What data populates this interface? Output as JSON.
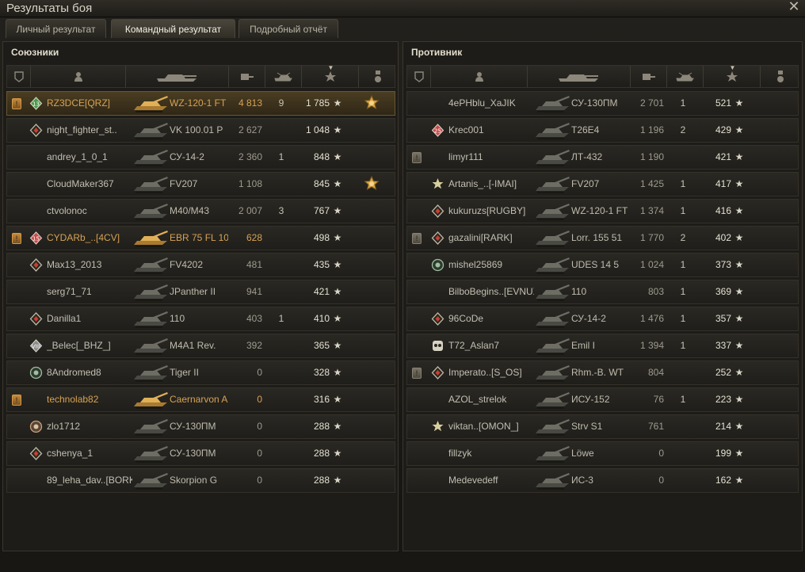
{
  "window": {
    "title": "Результаты боя"
  },
  "tabs": [
    {
      "label": "Личный результат",
      "active": false
    },
    {
      "label": "Командный результат",
      "active": true
    },
    {
      "label": "Подробный отчёт",
      "active": false
    }
  ],
  "allies": {
    "title": "Союзники",
    "rows": [
      {
        "squad": "",
        "badge": "rank-13-icon",
        "badge_text": "13",
        "name": "RZ3DCE[QRZ]",
        "tank": "WZ-120-1 FT",
        "damage": "4 813",
        "frags": "9",
        "xp": "1 785",
        "medal": true,
        "self": true,
        "platoon": true
      },
      {
        "squad": "",
        "badge": "diamond-icon",
        "name": "night_fighter_st..",
        "tank": "VK 100.01 P",
        "damage": "2 627",
        "frags": "",
        "xp": "1 048",
        "medal": false
      },
      {
        "squad": "",
        "badge": "",
        "name": "andrey_1_0_1",
        "tank": "СУ-14-2",
        "damage": "2 360",
        "frags": "1",
        "xp": "848",
        "medal": false
      },
      {
        "squad": "",
        "badge": "",
        "name": "CloudMaker367",
        "tank": "FV207",
        "damage": "1 108",
        "frags": "",
        "xp": "845",
        "medal": true
      },
      {
        "squad": "",
        "badge": "",
        "name": "ctvolonoc",
        "tank": "M40/M43",
        "damage": "2 007",
        "frags": "3",
        "xp": "767",
        "medal": false
      },
      {
        "squad": "",
        "badge": "rank-15-icon",
        "badge_text": "15",
        "name": "CYDARb_..[4CV]",
        "tank": "EBR 75 FL 10",
        "damage": "628",
        "frags": "",
        "xp": "498",
        "medal": false,
        "platoon": true
      },
      {
        "squad": "",
        "badge": "diamond-icon",
        "name": "Max13_2013",
        "tank": "FV4202",
        "damage": "481",
        "frags": "",
        "xp": "435",
        "medal": false
      },
      {
        "squad": "",
        "badge": "",
        "name": "serg71_71",
        "tank": "JPanther II",
        "damage": "941",
        "frags": "",
        "xp": "421",
        "medal": false
      },
      {
        "squad": "",
        "badge": "diamond-icon",
        "name": "Danilla1",
        "tank": "110",
        "damage": "403",
        "frags": "1",
        "xp": "410",
        "medal": false
      },
      {
        "squad": "",
        "badge": "rank-8-icon",
        "badge_text": "VIII",
        "name": "_Belec[_BHZ_]",
        "tank": "M4A1 Rev.",
        "damage": "392",
        "frags": "",
        "xp": "365",
        "medal": false
      },
      {
        "squad": "",
        "badge": "target-icon",
        "name": "8Andromed8",
        "tank": "Tiger II",
        "damage": "0",
        "frags": "",
        "xp": "328",
        "medal": false
      },
      {
        "squad": "",
        "badge": "",
        "name": "technolab82",
        "tank": "Caernarvon A",
        "damage": "0",
        "frags": "",
        "xp": "316",
        "medal": false,
        "platoon": true
      },
      {
        "squad": "",
        "badge": "circle-icon",
        "name": "zlo1712",
        "tank": "СУ-130ПМ",
        "damage": "0",
        "frags": "",
        "xp": "288",
        "medal": false
      },
      {
        "squad": "",
        "badge": "diamond-icon",
        "name": "cshenya_1",
        "tank": "СУ-130ПМ",
        "damage": "0",
        "frags": "",
        "xp": "288",
        "medal": false
      },
      {
        "squad": "",
        "badge": "",
        "name": "89_leha_dav..[BORKI]",
        "tank": "Skorpion G",
        "damage": "0",
        "frags": "",
        "xp": "288",
        "medal": false
      }
    ]
  },
  "enemies": {
    "title": "Противник",
    "rows": [
      {
        "squad": "",
        "badge": "",
        "name": "4ePHblu_XaJIK",
        "tank": "СУ-130ПМ",
        "damage": "2 701",
        "frags": "1",
        "xp": "521",
        "medal": false
      },
      {
        "squad": "",
        "badge": "rank-25-icon",
        "badge_text": "25",
        "name": "Krec001",
        "tank": "T26E4",
        "damage": "1 196",
        "frags": "2",
        "xp": "429",
        "medal": false
      },
      {
        "squad": "",
        "badge": "",
        "name": "limyr111",
        "tank": "ЛТ-432",
        "damage": "1 190",
        "frags": "",
        "xp": "421",
        "medal": false,
        "squad_mark": true
      },
      {
        "squad": "",
        "badge": "star-icon",
        "name": "Artanis_..[-IMAI]",
        "tank": "FV207",
        "damage": "1 425",
        "frags": "1",
        "xp": "417",
        "medal": false
      },
      {
        "squad": "",
        "badge": "diamond-icon",
        "name": "kukuruzs[RUGBY]",
        "tank": "WZ-120-1 FT",
        "damage": "1 374",
        "frags": "1",
        "xp": "416",
        "medal": false
      },
      {
        "squad": "",
        "badge": "diamond-icon",
        "name": "gazalini[RARK]",
        "tank": "Lorr. 155 51",
        "damage": "1 770",
        "frags": "2",
        "xp": "402",
        "medal": false,
        "squad_mark": true
      },
      {
        "squad": "",
        "badge": "target-icon",
        "name": "mishel25869",
        "tank": "UDES 14 5",
        "damage": "1 024",
        "frags": "1",
        "xp": "373",
        "medal": false
      },
      {
        "squad": "",
        "badge": "",
        "name": "BilboBegins..[EVNUX]",
        "tank": "110",
        "damage": "803",
        "frags": "1",
        "xp": "369",
        "medal": false
      },
      {
        "squad": "",
        "badge": "diamond-icon",
        "name": "96CoDe",
        "tank": "СУ-14-2",
        "damage": "1 476",
        "frags": "1",
        "xp": "357",
        "medal": false
      },
      {
        "squad": "",
        "badge": "skull-icon",
        "name": "T72_Aslan7",
        "tank": "Emil I",
        "damage": "1 394",
        "frags": "1",
        "xp": "337",
        "medal": false
      },
      {
        "squad": "",
        "badge": "diamond-icon",
        "name": "Imperato..[S_OS]",
        "tank": "Rhm.-B. WT",
        "damage": "804",
        "frags": "",
        "xp": "252",
        "medal": false,
        "squad_mark": true
      },
      {
        "squad": "",
        "badge": "",
        "name": "AZOL_strelok",
        "tank": "ИСУ-152",
        "damage": "76",
        "frags": "1",
        "xp": "223",
        "medal": false
      },
      {
        "squad": "",
        "badge": "star-icon",
        "name": "viktan..[OMON_]",
        "tank": "Strv S1",
        "damage": "761",
        "frags": "",
        "xp": "214",
        "medal": false
      },
      {
        "squad": "",
        "badge": "",
        "name": "fillzyk",
        "tank": "Löwe",
        "damage": "0",
        "frags": "",
        "xp": "199",
        "medal": false
      },
      {
        "squad": "",
        "badge": "",
        "name": "Medevedeff",
        "tank": "ИС-3",
        "damage": "0",
        "frags": "",
        "xp": "162",
        "medal": false
      }
    ]
  },
  "colors": {
    "self_row": "#4a3d22",
    "platoon_text": "#d6a254",
    "row_bg": "#2a2823"
  }
}
